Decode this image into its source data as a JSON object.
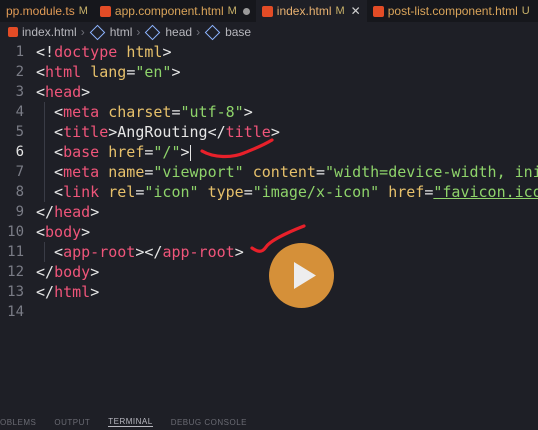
{
  "tabs": [
    {
      "label": "pp.module.ts",
      "modified": "M",
      "type": "ts",
      "state": "plain"
    },
    {
      "label": "app.component.html",
      "modified": "M",
      "type": "html",
      "state": "dot"
    },
    {
      "label": "index.html",
      "modified": "M",
      "type": "html",
      "state": "active"
    },
    {
      "label": "post-list.component.html",
      "modified": "U",
      "type": "html",
      "state": "plain"
    }
  ],
  "breadcrumb": [
    "index.html",
    "html",
    "head",
    "base"
  ],
  "line_numbers": [
    "1",
    "2",
    "3",
    "4",
    "5",
    "6",
    "7",
    "8",
    "9",
    "10",
    "11",
    "12",
    "13",
    "14"
  ],
  "code": {
    "l1_doctype": "doctype",
    "l1_html": "html",
    "l2_tag": "html",
    "l2_attr": "lang",
    "l2_val": "\"en\"",
    "l3_tag": "head",
    "l4_tag": "meta",
    "l4_attr": "charset",
    "l4_val": "\"utf-8\"",
    "l5_tag": "title",
    "l5_text": "AngRouting",
    "l5_close": "title",
    "l6_tag": "base",
    "l6_attr": "href",
    "l6_val": "\"/\"",
    "l7_tag": "meta",
    "l7_attr1": "name",
    "l7_val1": "\"viewport\"",
    "l7_attr2": "content",
    "l7_val2": "\"width=device-width, ini",
    "l8_tag": "link",
    "l8_attr1": "rel",
    "l8_val1": "\"icon\"",
    "l8_attr2": "type",
    "l8_val2": "\"image/x-icon\"",
    "l8_attr3": "href",
    "l8_val3": "\"favicon.ico",
    "l9_tag": "head",
    "l10_tag": "body",
    "l11_tag": "app-root",
    "l11_close": "app-root",
    "l12_tag": "body",
    "l13_tag": "html"
  },
  "panel_tabs": [
    "OBLEMS",
    "OUTPUT",
    "TERMINAL",
    "DEBUG CONSOLE"
  ],
  "colors": {
    "tag": "#f0557a",
    "attr": "#e6c06b",
    "string": "#8ed36a",
    "annotation": "#e8202a",
    "play": "#e59a3b"
  }
}
